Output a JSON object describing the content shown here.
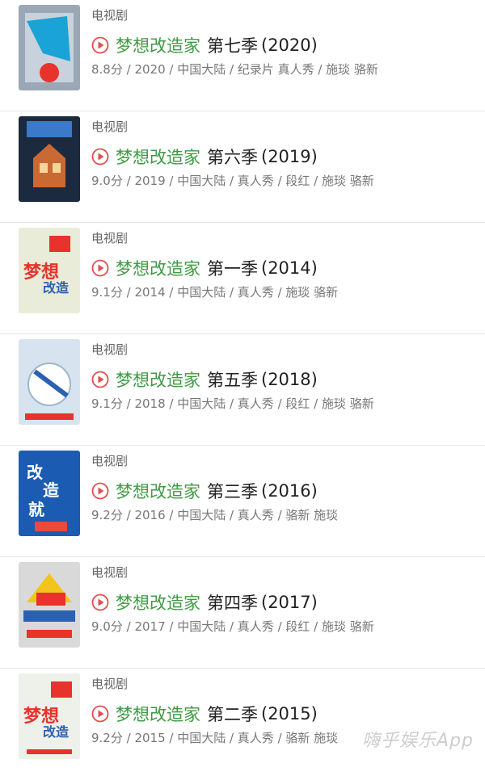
{
  "items": [
    {
      "category": "电视剧",
      "name": "梦想改造家",
      "season": "第七季",
      "year": "(2020)",
      "meta": "8.8分 / 2020 / 中国大陆 / 纪录片 真人秀 / 施琰 骆新",
      "poster_bg": "#9aa7b5",
      "poster_accent": "#1aa3d6"
    },
    {
      "category": "电视剧",
      "name": "梦想改造家",
      "season": "第六季",
      "year": "(2019)",
      "meta": "9.0分 / 2019 / 中国大陆 / 真人秀 / 段红 / 施琰 骆新",
      "poster_bg": "#1c2a3f",
      "poster_accent": "#c96a34"
    },
    {
      "category": "电视剧",
      "name": "梦想改造家",
      "season": "第一季",
      "year": "(2014)",
      "meta": "9.1分 / 2014 / 中国大陆 / 真人秀 / 施琰 骆新",
      "poster_bg": "#e9ecd8",
      "poster_accent": "#e8322c"
    },
    {
      "category": "电视剧",
      "name": "梦想改造家",
      "season": "第五季",
      "year": "(2018)",
      "meta": "9.1分 / 2018 / 中国大陆 / 真人秀 / 段红 / 施琰 骆新",
      "poster_bg": "#d7e4ef",
      "poster_accent": "#2a62b0"
    },
    {
      "category": "电视剧",
      "name": "梦想改造家",
      "season": "第三季",
      "year": "(2016)",
      "meta": "9.2分 / 2016 / 中国大陆 / 真人秀 / 骆新 施琰",
      "poster_bg": "#1b5cb2",
      "poster_accent": "#e94a3a"
    },
    {
      "category": "电视剧",
      "name": "梦想改造家",
      "season": "第四季",
      "year": "(2017)",
      "meta": "9.0分 / 2017 / 中国大陆 / 真人秀 / 段红 / 施琰 骆新",
      "poster_bg": "#d9d9d9",
      "poster_accent": "#f2c51d"
    },
    {
      "category": "电视剧",
      "name": "梦想改造家",
      "season": "第二季",
      "year": "(2015)",
      "meta": "9.2分 / 2015 / 中国大陆 / 真人秀 / 骆新 施琰",
      "poster_bg": "#eef0ea",
      "poster_accent": "#e8322c"
    }
  ],
  "watermark": "嗨乎娱乐App",
  "colors": {
    "title_green": "#3f9a43",
    "play_red": "#e24e4e",
    "divider": "#e6e6e6"
  }
}
